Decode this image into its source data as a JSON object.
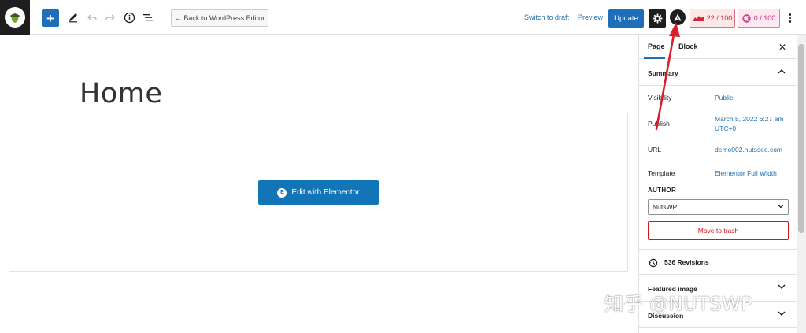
{
  "toolbar": {
    "back_label": "← Back to WordPress Editor",
    "switch_draft_label": "Switch to draft",
    "preview_label": "Preview",
    "update_label": "Update",
    "seo_score": "22 / 100",
    "readability_score": "0 / 100"
  },
  "editor": {
    "page_title": "Home",
    "elementor_button_label": "Edit with Elementor",
    "elementor_badge": "E"
  },
  "sidebar": {
    "tabs": [
      "Page",
      "Block"
    ],
    "close_label": "✕",
    "summary_title": "Summary",
    "rows": [
      {
        "label": "Visibility",
        "value": "Public"
      },
      {
        "label": "Publish",
        "value": "March 5, 2022 6:27 am UTC+0"
      },
      {
        "label": "URL",
        "value": "demo002.nutsseo.com"
      },
      {
        "label": "Template",
        "value": "Elementor Full Width"
      }
    ],
    "author_label": "AUTHOR",
    "author_value": "NutsWP",
    "trash_label": "Move to trash",
    "revisions_label": "536 Revisions",
    "featured_image_title": "Featured image",
    "discussion_title": "Discussion"
  },
  "watermark": "知乎 @NUTSWP",
  "colors": {
    "accent": "#1e6fba",
    "annotation_arrow": "#d8202c",
    "danger": "#cc1818"
  }
}
